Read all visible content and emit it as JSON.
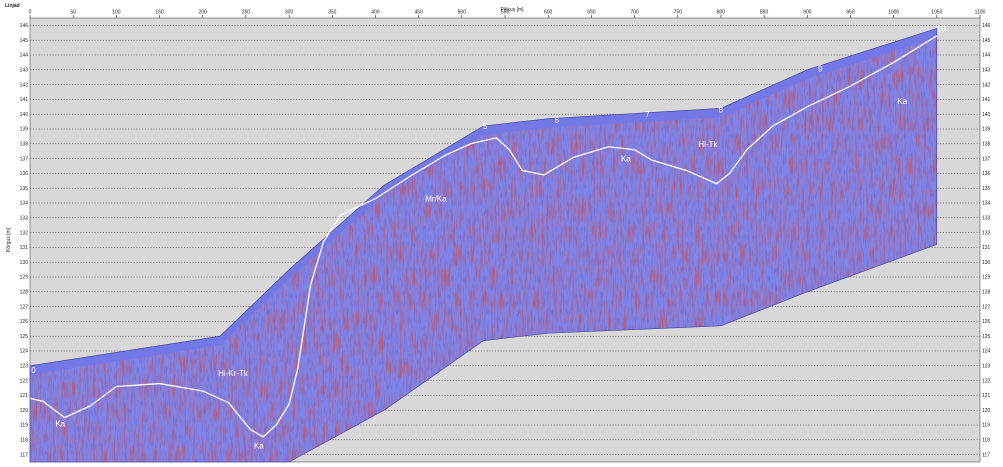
{
  "chart_data": {
    "type": "area",
    "corner_label": "Linjad",
    "xlabel": "Pikkus [m]",
    "ylabel": "Kõrgus [m]",
    "xlim": [
      0,
      1100
    ],
    "ylim": [
      116.5,
      146.5
    ],
    "x_ticks": [
      0,
      50,
      100,
      150,
      200,
      250,
      300,
      350,
      400,
      450,
      500,
      550,
      600,
      650,
      700,
      750,
      800,
      850,
      900,
      950,
      1000,
      1050,
      1100
    ],
    "y_ticks": [
      117,
      118,
      119,
      120,
      121,
      122,
      123,
      124,
      125,
      126,
      127,
      128,
      129,
      130,
      131,
      132,
      133,
      134,
      135,
      136,
      137,
      138,
      139,
      140,
      141,
      142,
      143,
      144,
      145,
      146
    ],
    "grid": true,
    "section": {
      "top": {
        "x": [
          0,
          220,
          300,
          410,
          525,
          600,
          800,
          900,
          1050
        ],
        "y": [
          123.0,
          125.0,
          129.5,
          135.2,
          139.2,
          139.7,
          140.4,
          143.0,
          145.8
        ]
      },
      "bottom": {
        "x": [
          0,
          210,
          300,
          410,
          525,
          600,
          800,
          900,
          1050
        ],
        "y": [
          116.5,
          116.5,
          116.5,
          120.0,
          124.7,
          125.2,
          125.7,
          128.0,
          131.2
        ]
      }
    },
    "colors": {
      "section": "#7f84e8",
      "surface_band": "#7478e6",
      "reflectors": "#a81c1c",
      "interpreted_horizon": "#ffffff",
      "background": "#d8d8d8",
      "grid": "#333333"
    },
    "interpreted_horizon": {
      "x": [
        0,
        15,
        40,
        70,
        100,
        150,
        200,
        230,
        255,
        270,
        285,
        300,
        310,
        325,
        340,
        360,
        400,
        440,
        480,
        510,
        540,
        555,
        570,
        595,
        630,
        670,
        700,
        720,
        760,
        795,
        810,
        830,
        860,
        900,
        950,
        1000,
        1050
      ],
      "y": [
        120.8,
        120.6,
        119.5,
        120.3,
        121.6,
        121.8,
        121.3,
        120.5,
        118.7,
        118.2,
        119.0,
        120.4,
        122.8,
        128.5,
        131.4,
        133.2,
        134.3,
        135.8,
        137.2,
        138.0,
        138.4,
        137.6,
        136.2,
        135.9,
        137.1,
        137.8,
        137.6,
        136.9,
        136.2,
        135.3,
        136.0,
        137.6,
        139.2,
        140.5,
        141.9,
        143.5,
        145.3
      ]
    },
    "annotations": [
      {
        "text": "Ka",
        "x": 35,
        "y": 118.9
      },
      {
        "text": "Ka",
        "x": 265,
        "y": 117.4
      },
      {
        "text": "Hi-Kr-Tk",
        "x": 235,
        "y": 122.3
      },
      {
        "text": "Mr/Ka",
        "x": 470,
        "y": 134.1
      },
      {
        "text": "Ka",
        "x": 690,
        "y": 136.8
      },
      {
        "text": "Hi-Tk",
        "x": 785,
        "y": 137.8
      },
      {
        "text": "Ka",
        "x": 1010,
        "y": 140.7
      },
      {
        "text": "5",
        "x": 527,
        "y": 139.0
      },
      {
        "text": "6",
        "x": 610,
        "y": 139.4
      },
      {
        "text": "7",
        "x": 715,
        "y": 139.8
      },
      {
        "text": "8",
        "x": 800,
        "y": 140.1
      },
      {
        "text": "9",
        "x": 915,
        "y": 142.9
      },
      {
        "text": "10",
        "x": 1055,
        "y": 145.6
      },
      {
        "text": "0",
        "x": 4,
        "y": 122.5
      }
    ]
  }
}
